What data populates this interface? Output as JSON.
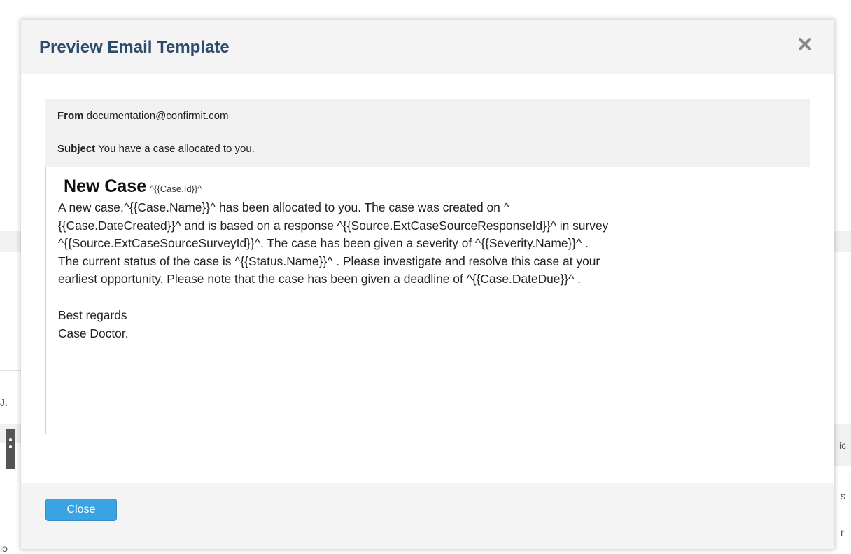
{
  "modal": {
    "title": "Preview Email Template",
    "close_icon": "close-icon"
  },
  "email": {
    "from_label": "From",
    "from_value": "documentation@confirmit.com",
    "subject_label": "Subject",
    "subject_value": "You have a case allocated to you.",
    "heading": "New Case",
    "heading_token": "^{{Case.Id}}^",
    "body_lines": [
      "A new case,^{{Case.Name}}^  has been allocated to you. The case was created on ^",
      "{{Case.DateCreated}}^ and is based on a response ^{{Source.ExtCaseSourceResponseId}}^ in survey",
      "^{{Source.ExtCaseSourceSurveyId}}^. The case has been given a severity of ^{{Severity.Name}}^ .",
      "The current status of the case is ^{{Status.Name}}^ . Please investigate and resolve this case at your",
      "earliest opportunity. Please note that the case has been given a deadline of ^{{Case.DateDue}}^ ."
    ],
    "signoff_1": "Best regards",
    "signoff_2": "Case Doctor."
  },
  "footer": {
    "close_label": "Close"
  },
  "background": {
    "edge_left": "J.",
    "edge_right_1": "ic",
    "edge_right_2": "s",
    "edge_right_3": "r",
    "edge_bottom_left": "lo"
  }
}
